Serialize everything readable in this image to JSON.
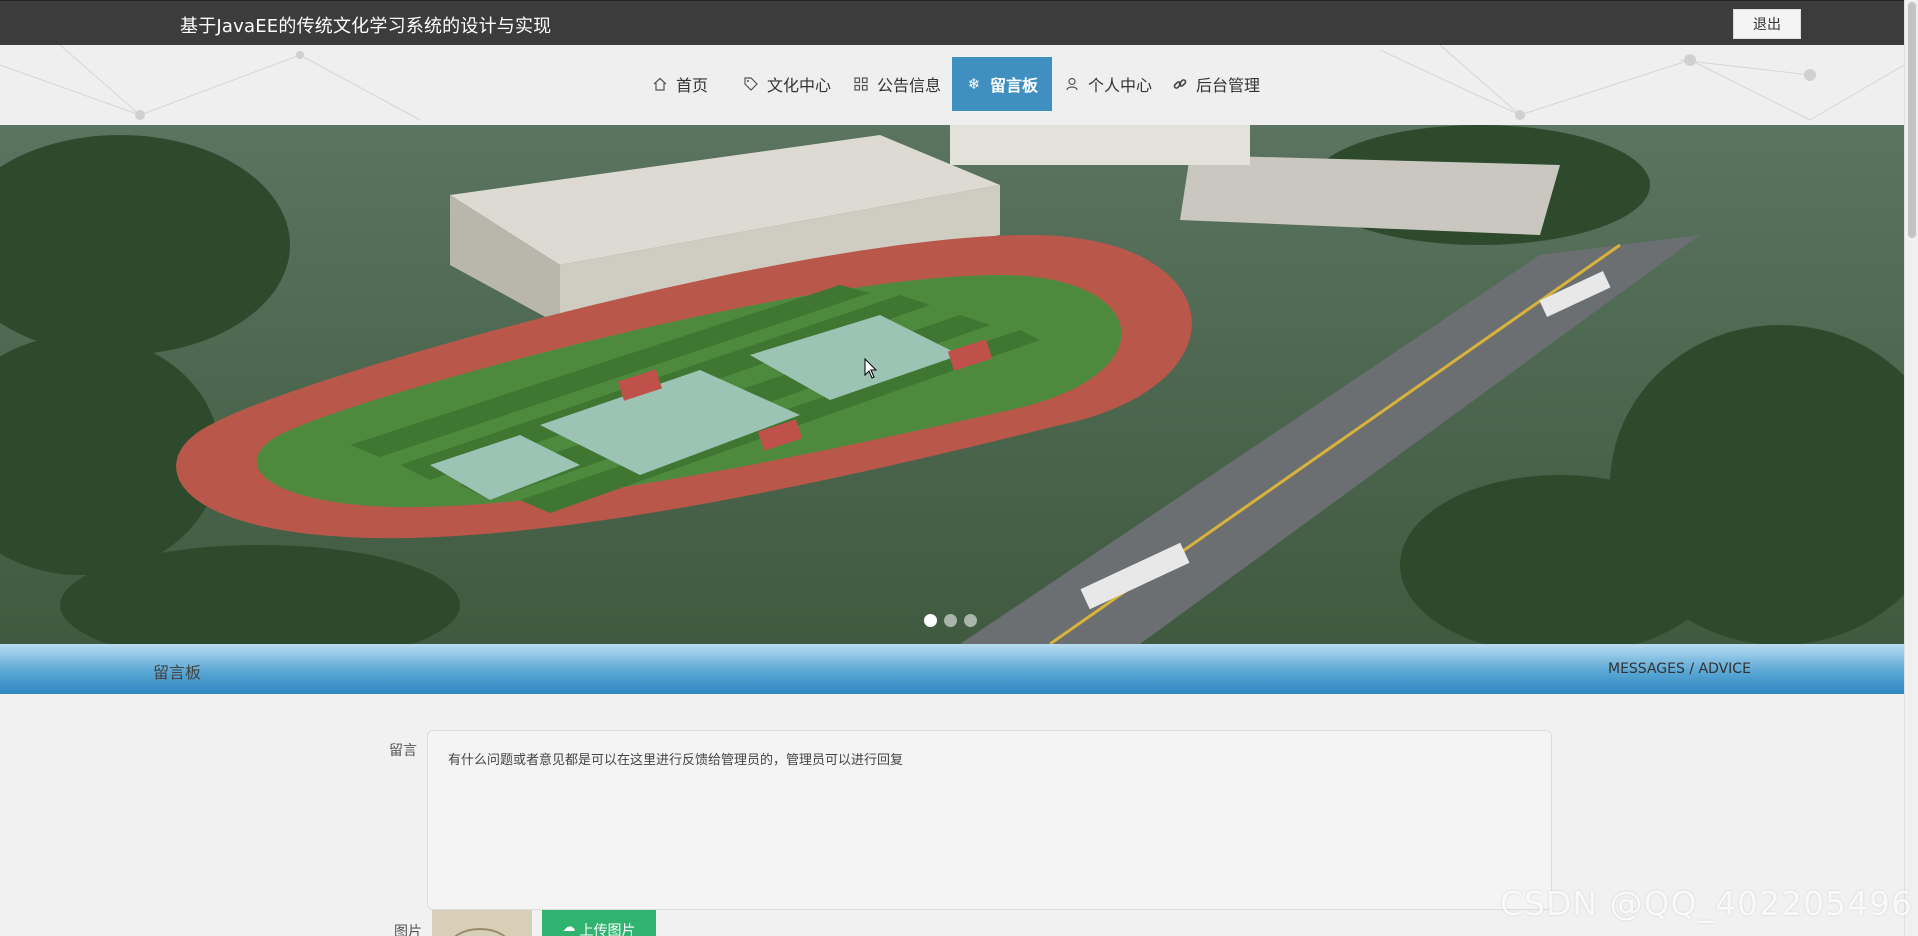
{
  "app": {
    "title": "基于JavaEE的传统文化学习系统的设计与实现",
    "logout_label": "退出"
  },
  "nav": {
    "items": [
      {
        "label": "首页",
        "icon": "home-icon"
      },
      {
        "label": "文化中心",
        "icon": "tag-icon"
      },
      {
        "label": "公告信息",
        "icon": "grid-icon"
      },
      {
        "label": "留言板",
        "icon": "snowflake-icon",
        "active": true
      },
      {
        "label": "个人中心",
        "icon": "user-icon"
      },
      {
        "label": "后台管理",
        "icon": "link-icon"
      }
    ],
    "active_color": "#3f8fc0"
  },
  "banner": {
    "slide_count": 3,
    "active_slide": 1
  },
  "section": {
    "title": "留言板",
    "subtitle": "MESSAGES / ADVICE"
  },
  "form": {
    "message_label": "留言",
    "message_value": "有什么问题或者意见都是可以在这里进行反馈给管理员的，管理员可以进行回复",
    "image_label": "图片",
    "upload_label": "上传图片"
  },
  "watermark": "CSDN @QQ_402205496"
}
